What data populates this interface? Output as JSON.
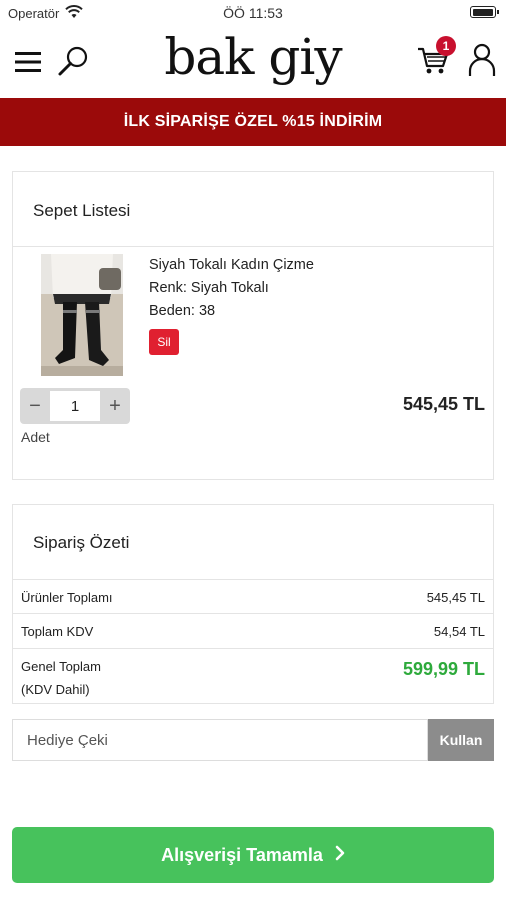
{
  "status_bar": {
    "carrier": "Operatör",
    "time": "ÖÖ 11:53",
    "battery_level": 1.0
  },
  "header": {
    "logo": "bak giy",
    "cart_count": "1"
  },
  "promo": {
    "text": "İLK SİPARİŞE ÖZEL %15 İNDİRİM"
  },
  "cart": {
    "title": "Sepet Listesi",
    "item": {
      "name": "Siyah Tokalı Kadın Çizme",
      "color": "Renk: Siyah Tokalı",
      "size": "Beden: 38",
      "delete_label": "Sil",
      "quantity": "1",
      "minus": "−",
      "plus": "+",
      "quantity_label": "Adet",
      "price": "545,45 TL"
    }
  },
  "summary": {
    "title": "Sipariş Özeti",
    "rows": [
      {
        "label": "Ürünler Toplamı",
        "value": "545,45 TL"
      },
      {
        "label": "Toplam KDV",
        "value": "54,54 TL"
      }
    ],
    "grand_label_1": "Genel Toplam",
    "grand_label_2": "(KDV Dahil)",
    "grand_value": "599,99 TL"
  },
  "gift": {
    "placeholder": "Hediye Çeki",
    "button": "Kullan"
  },
  "checkout": {
    "label": "Alışverişi Tamamla"
  },
  "colors": {
    "promo_bg": "#9b0a0a",
    "checkout_bg": "#47c25c",
    "grand_total": "#2eaa3c",
    "badge": "#c8102e",
    "delete": "#e02030"
  }
}
